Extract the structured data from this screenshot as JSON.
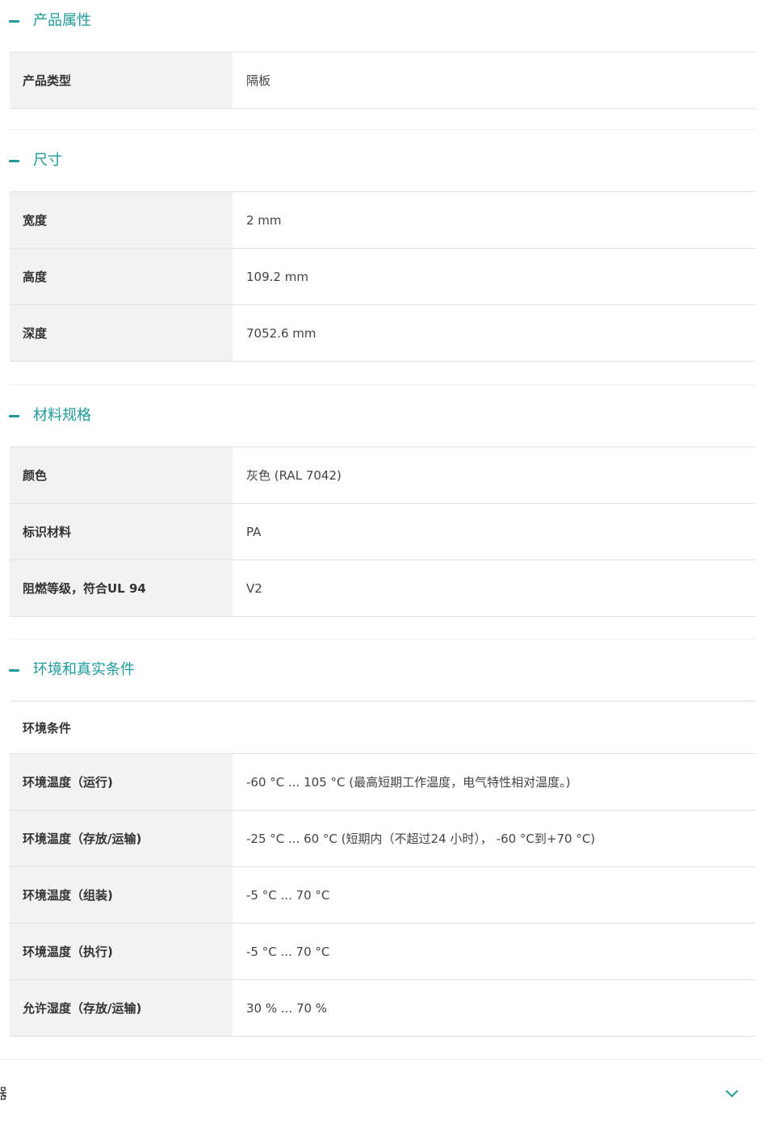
{
  "sections": [
    {
      "title": "产品属性",
      "rows": [
        {
          "label": "产品类型",
          "value": "隔板"
        }
      ]
    },
    {
      "title": "尺寸",
      "rows": [
        {
          "label": "宽度",
          "value": "2 mm"
        },
        {
          "label": "高度",
          "value": "109.2 mm"
        },
        {
          "label": "深度",
          "value": "7052.6 mm"
        }
      ]
    },
    {
      "title": "材料规格",
      "rows": [
        {
          "label": "颜色",
          "value": "灰色 (RAL 7042)"
        },
        {
          "label": "标识材料",
          "value": "PA"
        },
        {
          "label": "阻燃等级，符合UL 94",
          "value": "V2"
        }
      ]
    },
    {
      "title": "环境和真实条件",
      "subheading": "环境条件",
      "rows": [
        {
          "label": "环境温度（运行)",
          "value": "-60 °C ... 105 °C (最高短期工作温度，电气特性相对温度。)"
        },
        {
          "label": "环境温度（存放/运输)",
          "value": "-25 °C ... 60 °C (短期内（不超过24  小时），  -60 °C到+70 °C)"
        },
        {
          "label": "环境温度（组装)",
          "value": "-5 °C ... 70 °C"
        },
        {
          "label": "环境温度（执行)",
          "value": "-5 °C ... 70 °C"
        },
        {
          "label": "允许湿度（存放/运输)",
          "value": "30 % ... 70 %"
        }
      ]
    }
  ],
  "footer": {
    "label": "器"
  },
  "colors": {
    "accent": "#1f9a9a",
    "label_bg": "#f2f2f2",
    "border": "#e1e1e1"
  }
}
